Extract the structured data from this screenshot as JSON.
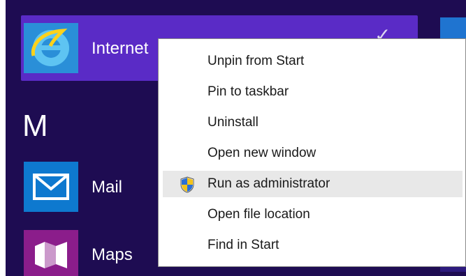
{
  "start_screen": {
    "group_letter": "M",
    "apps": [
      {
        "label": "Internet",
        "icon": "internet-explorer-icon",
        "selected": true
      },
      {
        "label": "Mail",
        "icon": "mail-icon"
      },
      {
        "label": "Maps",
        "icon": "maps-icon"
      }
    ],
    "selection_mark": "✓"
  },
  "context_menu": {
    "items": [
      {
        "label": "Unpin from Start"
      },
      {
        "label": "Pin to taskbar"
      },
      {
        "label": "Uninstall"
      },
      {
        "label": "Open new window"
      },
      {
        "label": "Run as administrator",
        "icon": "uac-shield-icon",
        "hovered": true
      },
      {
        "label": "Open file location"
      },
      {
        "label": "Find in Start"
      }
    ]
  },
  "colors": {
    "background": "#1e0c52",
    "selected_tile": "#5a2bc6",
    "menu_hover": "#e8e8e8"
  }
}
